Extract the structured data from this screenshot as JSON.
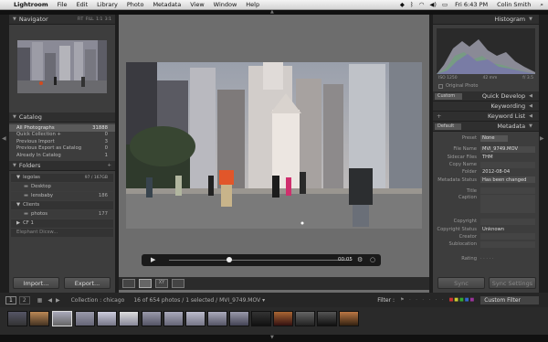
{
  "menubar": {
    "apple": "",
    "app": "Lightroom",
    "items": [
      "File",
      "Edit",
      "Library",
      "Photo",
      "Metadata",
      "View",
      "Window",
      "Help"
    ],
    "right_icons": [
      "dropbox-icon",
      "bluetooth-icon",
      "wifi-icon",
      "volume-icon",
      "battery-icon"
    ],
    "time": "Fri 6:43 PM",
    "user": "Colin Smith"
  },
  "navigator": {
    "title": "Navigator",
    "zoom_options": [
      "FIT",
      "FILL",
      "1:1",
      "3:1"
    ]
  },
  "catalog": {
    "title": "Catalog",
    "items": [
      {
        "label": "All Photographs",
        "count": "31888"
      },
      {
        "label": "Quick Collection +",
        "count": "0"
      },
      {
        "label": "Previous Import",
        "count": "3"
      },
      {
        "label": "Previous Export as Catalog",
        "count": "0"
      },
      {
        "label": "Already In Catalog",
        "count": "1"
      }
    ]
  },
  "folders": {
    "title": "Folders",
    "volumes": [
      {
        "name": "legolas",
        "stats": "97 / 167GB",
        "folders": [
          {
            "name": "Desktop",
            "count": ""
          },
          {
            "name": "lensbaby",
            "count": "186"
          }
        ]
      },
      {
        "name": "Clients",
        "stats": "",
        "folders": [
          {
            "name": "photos",
            "count": "177"
          }
        ]
      },
      {
        "name": "CF 1",
        "stats": "",
        "folders": []
      }
    ],
    "extra_folder": "Elephant Dicsw..."
  },
  "left_buttons": {
    "import": "Import...",
    "export": "Export..."
  },
  "video": {
    "time": "00:05"
  },
  "histogram": {
    "title": "Histogram",
    "iso": "ISO 1250",
    "focal": "42 mm",
    "aperture": "f/ 3.5",
    "original_photo": "Original Photo"
  },
  "quick_develop": {
    "title": "Quick Develop",
    "preset": "Custom"
  },
  "keywording": {
    "title": "Keywording"
  },
  "keyword_list": {
    "title": "Keyword List"
  },
  "metadata": {
    "title": "Metadata",
    "preset_label": "Default",
    "preset_row": {
      "key": "Preset",
      "value": "None"
    },
    "rows": [
      {
        "key": "File Name",
        "value": "MVI_9749.MOV"
      },
      {
        "key": "Sidecar Files",
        "value": "THM"
      },
      {
        "key": "Copy Name",
        "value": ""
      },
      {
        "key": "Folder",
        "value": "2012-08-04"
      },
      {
        "key": "Metadata Status",
        "value": "Has been changed"
      }
    ],
    "rows2": [
      {
        "key": "Title",
        "value": ""
      },
      {
        "key": "Caption",
        "value": ""
      }
    ],
    "rows3": [
      {
        "key": "Copyright",
        "value": ""
      },
      {
        "key": "Copyright Status",
        "value": "Unknown"
      },
      {
        "key": "Creator",
        "value": ""
      },
      {
        "key": "Sublocation",
        "value": ""
      }
    ],
    "rating_label": "Rating"
  },
  "right_buttons": {
    "sync": "Sync",
    "sync_settings": "Sync Settings"
  },
  "filmstrip_bar": {
    "pages": [
      "1",
      "2"
    ],
    "collection": "Collection : chicago",
    "count": "16 of 654 photos / 1 selected / MVI_9749.MOV ▾",
    "filter_label": "Filter :",
    "filter_value": "Custom Filter"
  }
}
